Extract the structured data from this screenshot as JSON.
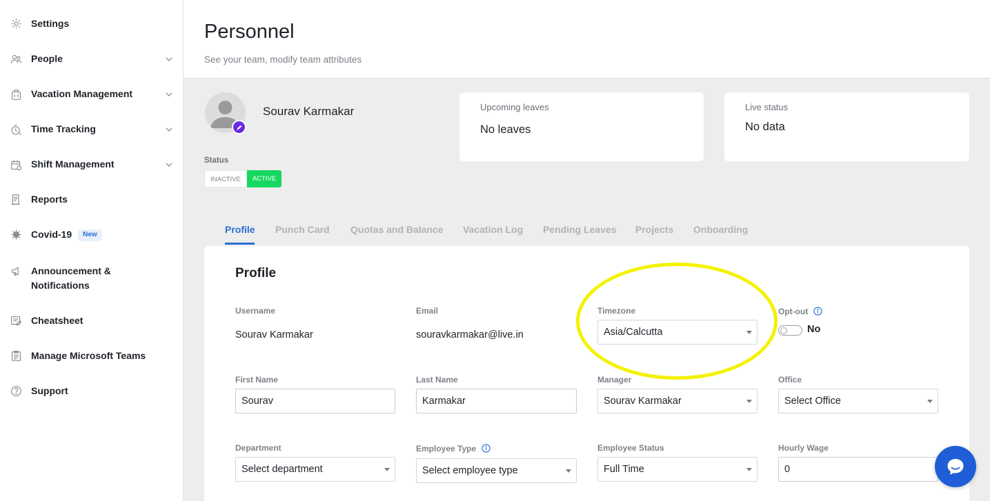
{
  "sidebar": {
    "items": [
      {
        "label": "Settings",
        "icon": "gear-icon",
        "has_chevron": false
      },
      {
        "label": "People",
        "icon": "people-icon",
        "has_chevron": true
      },
      {
        "label": "Vacation Management",
        "icon": "suitcase-icon",
        "has_chevron": true
      },
      {
        "label": "Time Tracking",
        "icon": "stopwatch-icon",
        "has_chevron": true
      },
      {
        "label": "Shift Management",
        "icon": "calendar-icon",
        "has_chevron": true
      },
      {
        "label": "Reports",
        "icon": "report-icon",
        "has_chevron": false
      },
      {
        "label": "Covid-19",
        "icon": "virus-icon",
        "has_chevron": false,
        "badge": "New"
      },
      {
        "label": "Announcement & Notifications",
        "icon": "megaphone-icon",
        "has_chevron": false
      },
      {
        "label": "Cheatsheet",
        "icon": "cheatsheet-icon",
        "has_chevron": false
      },
      {
        "label": "Manage Microsoft Teams",
        "icon": "clipboard-icon",
        "has_chevron": false
      },
      {
        "label": "Support",
        "icon": "help-circle-icon",
        "has_chevron": false
      }
    ]
  },
  "header": {
    "title": "Personnel",
    "subtitle": "See your team, modify team attributes"
  },
  "profile_summary": {
    "name": "Sourav Karmakar",
    "status_label": "Status",
    "status_options": [
      "Inactive",
      "Active"
    ],
    "status_selected": "Active"
  },
  "cards": {
    "upcoming_leaves": {
      "label": "Upcoming leaves",
      "value": "No leaves"
    },
    "live_status": {
      "label": "Live status",
      "value": "No data"
    }
  },
  "tabs": [
    "Profile",
    "Punch Card",
    "Quotas and Balance",
    "Vacation Log",
    "Pending Leaves",
    "Projects",
    "Onboarding"
  ],
  "selected_tab": "Profile",
  "profile_form": {
    "title": "Profile",
    "username": {
      "label": "Username",
      "value": "Sourav Karmakar"
    },
    "email": {
      "label": "Email",
      "value": "souravkarmakar@live.in"
    },
    "timezone": {
      "label": "Timezone",
      "value": "Asia/Calcutta"
    },
    "opt_out": {
      "label": "Opt-out",
      "value": "No"
    },
    "first_name": {
      "label": "First Name",
      "value": "Sourav"
    },
    "last_name": {
      "label": "Last Name",
      "value": "Karmakar"
    },
    "manager": {
      "label": "Manager",
      "value": "Sourav Karmakar"
    },
    "office": {
      "label": "Office",
      "value": "Select Office"
    },
    "department": {
      "label": "Department",
      "value": "Select department"
    },
    "employee_type": {
      "label": "Employee Type",
      "value": "Select employee type"
    },
    "employee_status": {
      "label": "Employee Status",
      "value": "Full Time"
    },
    "hourly_wage": {
      "label": "Hourly Wage",
      "value": "0"
    }
  },
  "colors": {
    "accent": "#2a6fd4",
    "active_green": "#16d860",
    "avatar_edit": "#6b2be0",
    "highlight": "#f4f200",
    "chat": "#1f5ed6"
  }
}
